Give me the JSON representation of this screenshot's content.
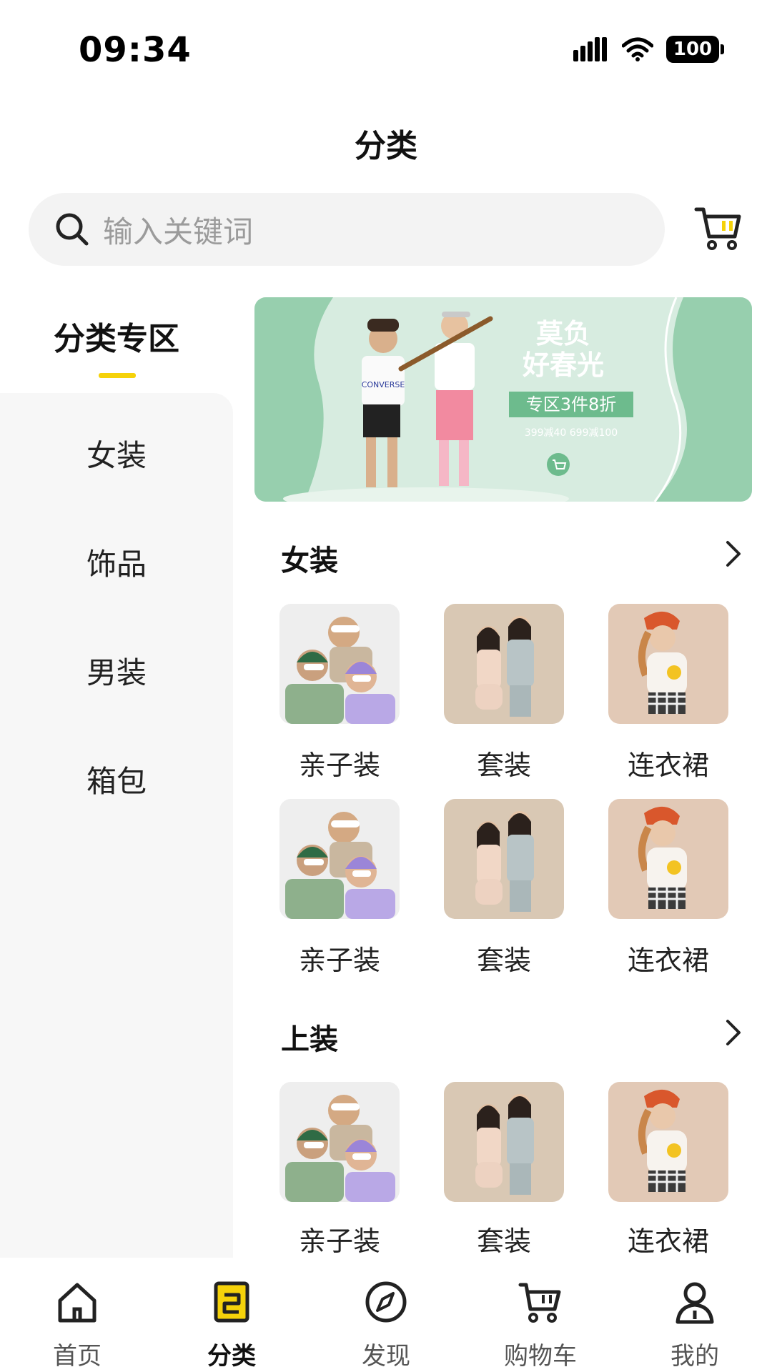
{
  "status_bar": {
    "time": "09:34",
    "battery": "100"
  },
  "header": {
    "title": "分类"
  },
  "search": {
    "placeholder": "输入关键词"
  },
  "sidebar": {
    "title": "分类专区",
    "items": [
      {
        "label": "女装"
      },
      {
        "label": "饰品"
      },
      {
        "label": "男装"
      },
      {
        "label": "箱包"
      }
    ]
  },
  "banner": {
    "title_line1": "莫负",
    "title_line2": "好春光",
    "tag": "专区3件8折",
    "promo": "399减40  699减100",
    "shirt_text": "CONVERSE"
  },
  "sections": [
    {
      "title": "女装",
      "items": [
        {
          "label": "亲子装"
        },
        {
          "label": "套装"
        },
        {
          "label": "连衣裙"
        },
        {
          "label": "亲子装"
        },
        {
          "label": "套装"
        },
        {
          "label": "连衣裙"
        }
      ]
    },
    {
      "title": "上装",
      "items": [
        {
          "label": "亲子装"
        },
        {
          "label": "套装"
        },
        {
          "label": "连衣裙"
        }
      ]
    }
  ],
  "tab_bar": {
    "tabs": [
      {
        "label": "首页",
        "icon": "home-icon"
      },
      {
        "label": "分类",
        "icon": "category-icon"
      },
      {
        "label": "发现",
        "icon": "compass-icon"
      },
      {
        "label": "购物车",
        "icon": "cart-icon"
      },
      {
        "label": "我的",
        "icon": "user-icon"
      }
    ],
    "active_index": 1
  },
  "colors": {
    "accent": "#f5d20a",
    "sidebar_bg": "#f7f7f7",
    "search_bg": "#f3f3f3"
  }
}
